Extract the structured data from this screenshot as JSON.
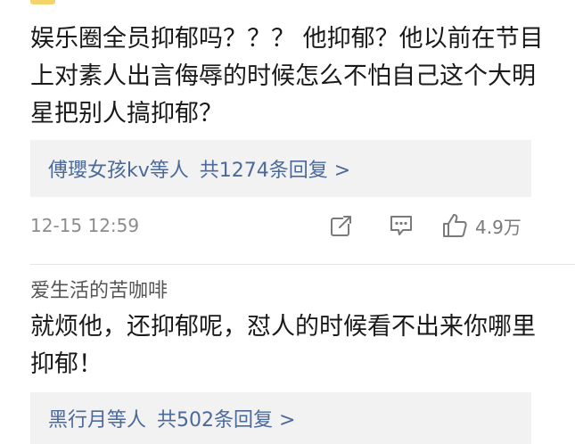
{
  "comment1": {
    "text": "娱乐圈全员抑郁吗？？？ 他抑郁？他以前在节目上对素人出言侮辱的时候怎么不怕自己这个大明星把别人搞抑郁？",
    "replies": {
      "users": "傅瓔女孩kv等人",
      "count": "共1274条回复 >"
    },
    "timestamp": "12-15 12:59",
    "likes": "4.9万"
  },
  "comment2": {
    "username": "爱生活的苦咖啡",
    "text": "就烦他，还抑郁呢，怼人的时候看不出来你哪里抑郁！",
    "replies": {
      "users": "黑行月等人",
      "count": "共502条回复 >"
    }
  },
  "colors": {
    "link": "#4b6a9b",
    "meta": "#8c8c8c",
    "reply_bg": "#f2f2f2"
  },
  "icons": [
    "share-icon",
    "comment-icon",
    "like-icon"
  ]
}
